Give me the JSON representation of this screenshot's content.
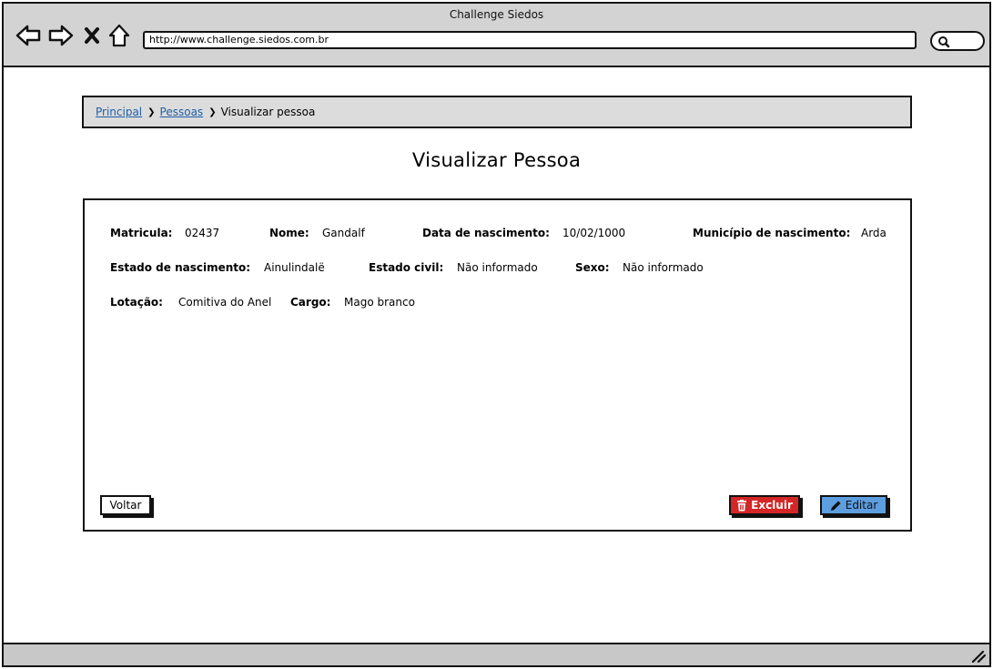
{
  "window": {
    "title": "Challenge Siedos"
  },
  "browser": {
    "url": "http://www.challenge.siedos.com.br",
    "nav_icons": [
      "back-arrow-icon",
      "forward-arrow-icon",
      "stop-x-icon",
      "home-icon",
      "search-icon"
    ]
  },
  "breadcrumb": {
    "items": [
      {
        "label": "Principal",
        "link": true
      },
      {
        "label": "Pessoas",
        "link": true
      },
      {
        "label": "Visualizar pessoa",
        "link": false
      }
    ],
    "separator_icon": "chevron-right-icon"
  },
  "page": {
    "title": "Visualizar Pessoa"
  },
  "person": {
    "matricula": {
      "label": "Matricula:",
      "value": "02437"
    },
    "nome": {
      "label": "Nome:",
      "value": "Gandalf"
    },
    "data_nascimento": {
      "label": "Data de nascimento:",
      "value": "10/02/1000"
    },
    "municipio_nascimento": {
      "label": "Município de nascimento:",
      "value": "Arda"
    },
    "estado_nascimento": {
      "label": "Estado de nascimento:",
      "value": "Ainulindalë"
    },
    "estado_civil": {
      "label": "Estado civil:",
      "value": "Não informado"
    },
    "sexo": {
      "label": "Sexo:",
      "value": "Não informado"
    },
    "lotacao": {
      "label": "Lotação:",
      "value": "Comitiva do Anel"
    },
    "cargo": {
      "label": "Cargo:",
      "value": "Mago branco"
    }
  },
  "actions": {
    "back_label": "Voltar",
    "delete_label": "Excluir",
    "delete_icon": "trash-icon",
    "edit_label": "Editar",
    "edit_icon": "pencil-icon"
  },
  "colors": {
    "delete": "#d42626",
    "edit": "#5c9ee0",
    "link": "#1f5fa8",
    "chrome": "#d3d3d3"
  }
}
